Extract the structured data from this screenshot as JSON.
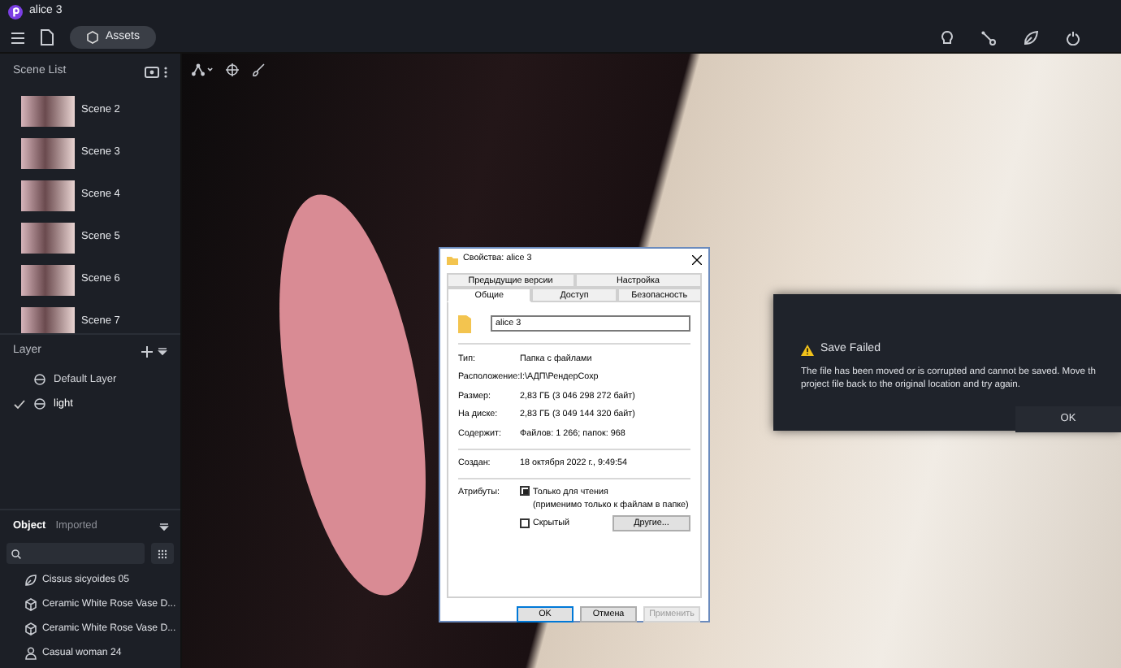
{
  "window": {
    "title": "alice 3"
  },
  "toolbar": {
    "assets_button": "Assets"
  },
  "scene_list": {
    "title": "Scene List",
    "scenes": [
      {
        "name": "Scene 2",
        "selected": false
      },
      {
        "name": "Scene 3",
        "selected": false
      },
      {
        "name": "Scene 4",
        "selected": false
      },
      {
        "name": "Scene 5",
        "selected": false
      },
      {
        "name": "Scene 6",
        "selected": false
      },
      {
        "name": "Scene 7",
        "selected": false
      }
    ]
  },
  "layers": {
    "title": "Layer",
    "items": [
      {
        "name": "Default Layer",
        "checked": false
      },
      {
        "name": "light",
        "checked": true
      }
    ]
  },
  "objects": {
    "tabs": [
      {
        "label": "Object",
        "selected": true
      },
      {
        "label": "Imported",
        "selected": false
      }
    ],
    "items": [
      {
        "kind": "plant",
        "name": "Cissus sicyoides 05"
      },
      {
        "kind": "model",
        "name": "Ceramic White Rose Vase D..."
      },
      {
        "kind": "model",
        "name": "Ceramic White Rose Vase D..."
      },
      {
        "kind": "person",
        "name": "Casual woman 24"
      }
    ]
  },
  "properties_dialog": {
    "title": "Свойства: alice 3",
    "tabs_back": [
      {
        "label": "Предыдущие версии",
        "selected": false
      },
      {
        "label": "Настройка",
        "selected": false
      }
    ],
    "tabs_front": [
      {
        "label": "Общие",
        "selected": true
      },
      {
        "label": "Доступ",
        "selected": false
      },
      {
        "label": "Безопасность",
        "selected": false
      }
    ],
    "name_value": "alice 3",
    "rows": [
      {
        "label": "Тип:",
        "value": "Папка с файлами"
      },
      {
        "label": "Расположение:",
        "value": "I:\\АДП\\РендерСохр"
      },
      {
        "label": "Размер:",
        "value": "2,83 ГБ (3 046 298 272 байт)"
      },
      {
        "label": "На диске:",
        "value": "2,83 ГБ (3 049 144 320 байт)"
      },
      {
        "label": "Содержит:",
        "value": "Файлов: 1 266; папок: 968"
      }
    ],
    "created": {
      "label": "Создан:",
      "value": "18 октября 2022 г., 9:49:54"
    },
    "attributes_label": "Атрибуты:",
    "readonly": {
      "label": "Только для чтения",
      "note": "(применимо только к файлам в папке)",
      "checked": true
    },
    "hidden": {
      "label": "Скрытый",
      "checked": false
    },
    "other_button": "Другие...",
    "buttons": [
      {
        "label": "OK",
        "disabled": false
      },
      {
        "label": "Отмена",
        "disabled": false
      },
      {
        "label": "Применить",
        "disabled": true
      }
    ]
  },
  "save_dialog": {
    "title": "Save Failed",
    "message_lines": [
      "The file has been moved or is corrupted and cannot be saved. Move th",
      "project file back to the original location and try again."
    ],
    "button": "OK"
  }
}
